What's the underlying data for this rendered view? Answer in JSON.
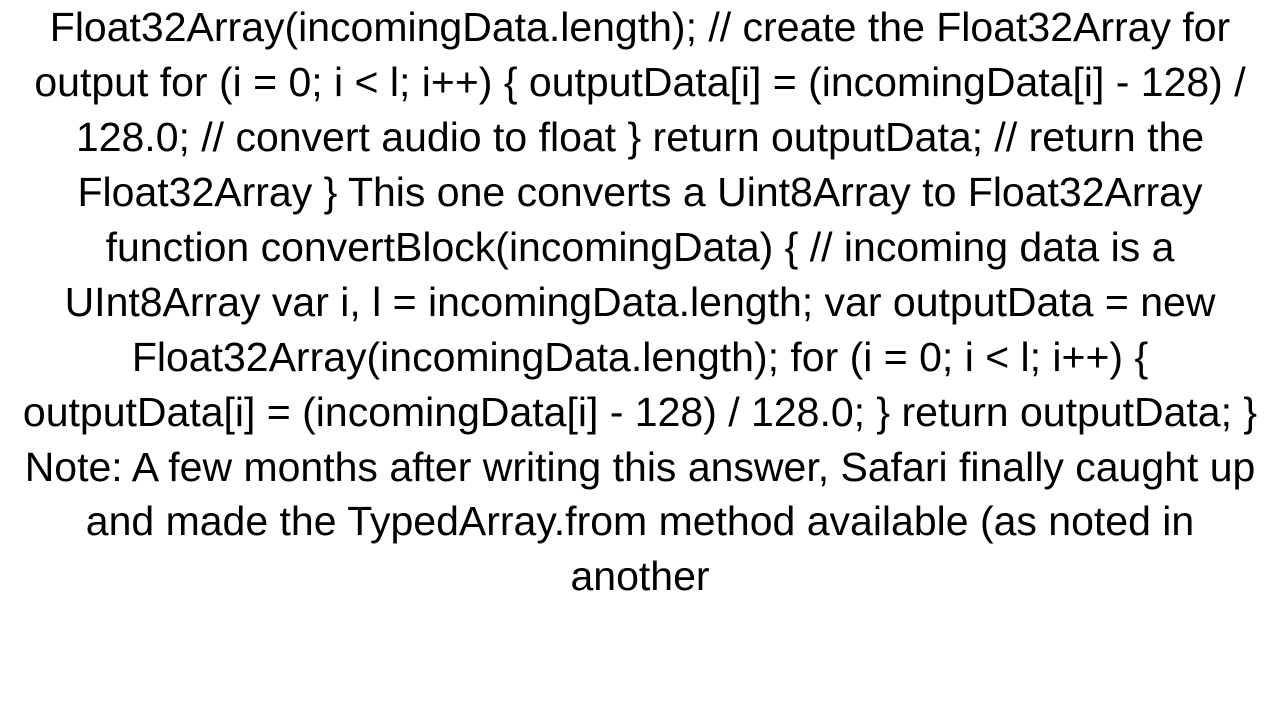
{
  "document": {
    "text": "Float32Array(incomingData.length); // create the Float32Array for output     for (i = 0; i < l; i++) {         outputData[i] = (incomingData[i] - 128) / 128.0; // convert audio to float     }     return outputData; // return the Float32Array }   This one converts a Uint8Array to Float32Array function convertBlock(incomingData) { // incoming data is a UInt8Array     var i, l = incomingData.length;     var outputData = new Float32Array(incomingData.length);     for (i = 0; i < l; i++) {         outputData[i] = (incomingData[i] - 128) / 128.0;     }     return outputData; }   Note: A few months after writing this answer, Safari finally caught up and made the TypedArray.from method available (as noted in another"
  }
}
